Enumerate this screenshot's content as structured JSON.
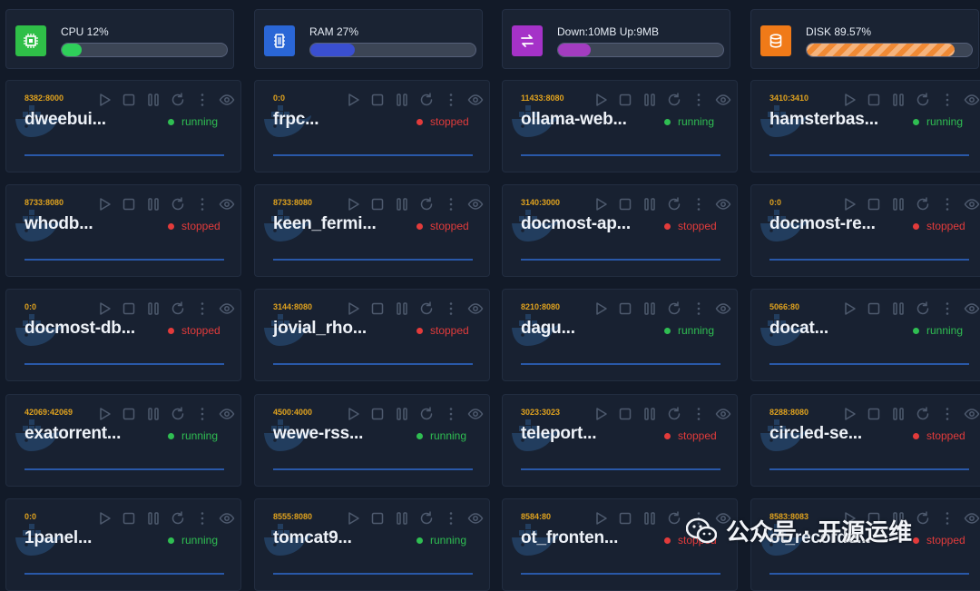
{
  "stats": [
    {
      "label": "CPU 12%",
      "icon": "cpu-icon",
      "color": "#2fbf48",
      "fill": "#2fcf5a",
      "percent": 12
    },
    {
      "label": "RAM 27%",
      "icon": "memory-icon",
      "color": "#2a66d6",
      "fill": "#3a4fd0",
      "percent": 27
    },
    {
      "label": "Down:10MB Up:9MB",
      "icon": "transfer-icon",
      "color": "#a532c8",
      "fill": "#a33cc0",
      "percent": 20
    },
    {
      "label": "DISK 89.57%",
      "icon": "database-icon",
      "color": "#f07a18",
      "fill": "#f08a35",
      "percent": 89.57
    }
  ],
  "colors": {
    "running": "#2fbe52",
    "stopped": "#e23b3b",
    "port": "#e0a21e"
  },
  "containers": [
    {
      "port": "8382:8000",
      "name": "dweebui...",
      "status": "running"
    },
    {
      "port": "0:0",
      "name": "frpc...",
      "status": "stopped"
    },
    {
      "port": "11433:8080",
      "name": "ollama-web...",
      "status": "running"
    },
    {
      "port": "3410:3410",
      "name": "hamsterbas...",
      "status": "running"
    },
    {
      "port": "8733:8080",
      "name": "whodb...",
      "status": "stopped"
    },
    {
      "port": "8733:8080",
      "name": "keen_fermi...",
      "status": "stopped"
    },
    {
      "port": "3140:3000",
      "name": "docmost-ap...",
      "status": "stopped"
    },
    {
      "port": "0:0",
      "name": "docmost-re...",
      "status": "stopped"
    },
    {
      "port": "0:0",
      "name": "docmost-db...",
      "status": "stopped"
    },
    {
      "port": "3144:8080",
      "name": "jovial_rho...",
      "status": "stopped"
    },
    {
      "port": "8210:8080",
      "name": "dagu...",
      "status": "running"
    },
    {
      "port": "5066:80",
      "name": "docat...",
      "status": "running"
    },
    {
      "port": "42069:42069",
      "name": "exatorrent...",
      "status": "running"
    },
    {
      "port": "4500:4000",
      "name": "wewe-rss...",
      "status": "running"
    },
    {
      "port": "3023:3023",
      "name": "teleport...",
      "status": "stopped"
    },
    {
      "port": "8288:8080",
      "name": "circled-se...",
      "status": "stopped"
    },
    {
      "port": "0:0",
      "name": "1panel...",
      "status": "running"
    },
    {
      "port": "8555:8080",
      "name": "tomcat9...",
      "status": "running"
    },
    {
      "port": "8584:80",
      "name": "ot_fronten...",
      "status": "stopped"
    },
    {
      "port": "8583:8083",
      "name": "ot_recorde...",
      "status": "stopped"
    }
  ],
  "watermark": {
    "text": "公众号 · 开源运维",
    "icon": "wechat-icon"
  }
}
